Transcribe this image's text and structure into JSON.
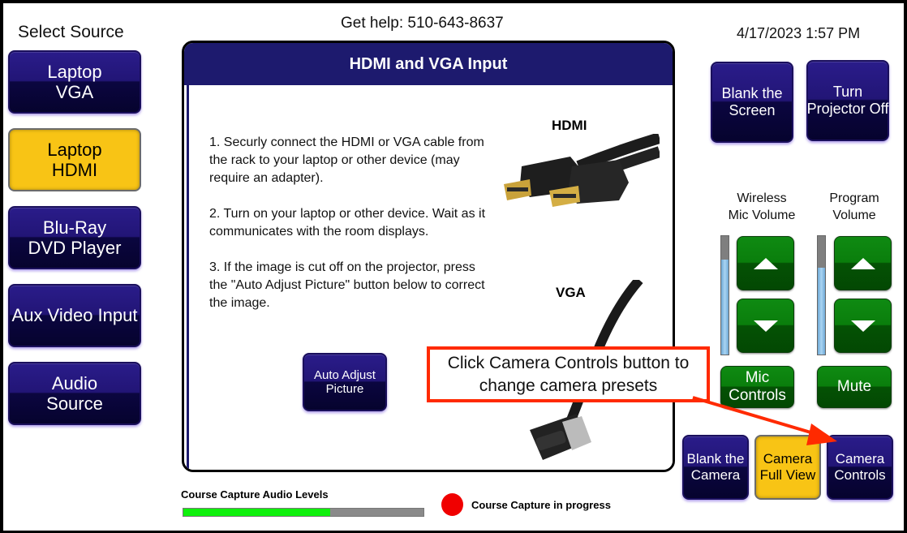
{
  "header": {
    "select_source": "Select Source",
    "help": "Get help: 510-643-8637",
    "datetime": "4/17/2023 1:57 PM"
  },
  "sources": [
    {
      "line1": "Laptop",
      "line2": "VGA",
      "selected": false
    },
    {
      "line1": "Laptop",
      "line2": "HDMI",
      "selected": true
    },
    {
      "line1": "Blu-Ray",
      "line2": "DVD Player",
      "selected": false
    },
    {
      "line1": "Aux Video Input",
      "line2": "",
      "selected": false
    },
    {
      "line1": "Audio",
      "line2": "Source",
      "selected": false
    }
  ],
  "panel": {
    "title": "HDMI and VGA Input",
    "steps": [
      "1. Securly connect the HDMI or VGA cable from the rack to your laptop or other device (may require an adapter).",
      "2. Turn on your laptop or other device. Wait as it communicates with the room displays.",
      "3. If the image is cut off on the projector, press the \"Auto Adjust Picture\" button below to correct the image."
    ],
    "hdmi_label": "HDMI",
    "vga_label": "VGA",
    "auto_adjust": {
      "line1": "Auto Adjust",
      "line2": "Picture"
    }
  },
  "callout": {
    "line1": "Click Camera Controls button to",
    "line2": "change camera presets",
    "color": "#ff2a00"
  },
  "display_controls": {
    "blank_screen": {
      "line1": "Blank the",
      "line2": "Screen"
    },
    "projector_off": {
      "line1": "Turn",
      "line2": "Projector Off"
    }
  },
  "audio": {
    "wireless_mic": {
      "line1": "Wireless",
      "line2": "Mic Volume",
      "level_percent": 80
    },
    "program": {
      "line1": "Program",
      "line2": "Volume",
      "level_percent": 73
    },
    "mic_controls": {
      "line1": "Mic",
      "line2": "Controls"
    },
    "mute": "Mute"
  },
  "camera": {
    "blank": {
      "line1": "Blank the",
      "line2": "Camera",
      "selected": false
    },
    "full_view": {
      "line1": "Camera",
      "line2": "Full View",
      "selected": true
    },
    "controls": {
      "line1": "Camera",
      "line2": "Controls",
      "selected": false
    }
  },
  "course_capture": {
    "audio_levels_label": "Course Capture Audio Levels",
    "audio_level_percent": 61,
    "status": "Course Capture in progress",
    "status_color": "#f00000",
    "meter_color": "#0ff00c"
  }
}
